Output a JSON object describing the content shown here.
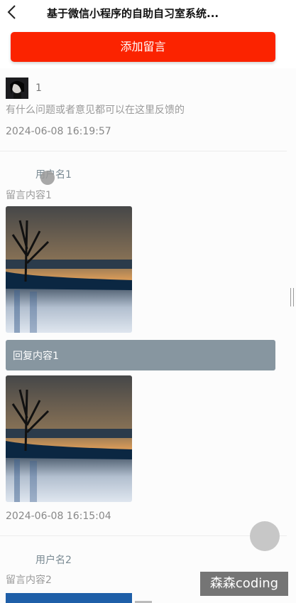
{
  "header": {
    "title": "基于微信小程序的自助自习室系统...",
    "back_icon": "chevron-left-icon"
  },
  "actions": {
    "add_message_label": "添加留言"
  },
  "messages": [
    {
      "username": "1",
      "content": "有什么问题或者意见都可以在这里反馈的",
      "time": "2024-06-08 16:19:57"
    },
    {
      "username": "用户名1",
      "content": "留言内容1",
      "reply": "回复内容1",
      "time": "2024-06-08 16:15:04"
    },
    {
      "username": "用户名2",
      "content": "留言内容2"
    }
  ],
  "watermark": "森森coding",
  "colors": {
    "primary_button": "#fb2300",
    "reply_bar": "#8796a0"
  }
}
